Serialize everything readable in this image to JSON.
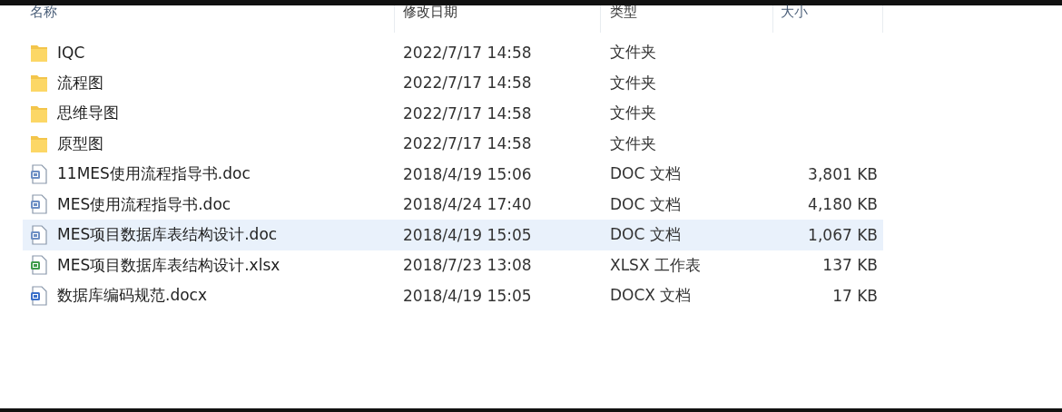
{
  "columns": [
    "名称",
    "修改日期",
    "类型",
    "大小"
  ],
  "files": [
    {
      "kind": "folder",
      "name": "IQC",
      "date": "2022/7/17 14:58",
      "type": "文件夹",
      "selected": false
    },
    {
      "kind": "folder",
      "name": "流程图",
      "date": "2022/7/17 14:58",
      "type": "文件夹",
      "selected": false
    },
    {
      "kind": "folder",
      "name": "思维导图",
      "date": "2022/7/17 14:58",
      "type": "文件夹",
      "selected": false
    },
    {
      "kind": "folder",
      "name": "原型图",
      "date": "2022/7/17 14:58",
      "type": "文件夹",
      "selected": false
    },
    {
      "kind": "doc",
      "name": "11MES使用流程指导书.doc",
      "date": "2018/4/19 15:06",
      "type": "DOC 文档",
      "size": "3,801 KB",
      "selected": false
    },
    {
      "kind": "doc",
      "name": "MES使用流程指导书.doc",
      "date": "2018/4/24 17:40",
      "type": "DOC 文档",
      "size": "4,180 KB",
      "selected": false
    },
    {
      "kind": "doc",
      "name": "MES项目数据库表结构设计.doc",
      "date": "2018/4/19 15:05",
      "type": "DOC 文档",
      "size": "1,067 KB",
      "selected": true
    },
    {
      "kind": "xlsx",
      "name": "MES项目数据库表结构设计.xlsx",
      "date": "2018/7/23 13:08",
      "type": "XLSX 工作表",
      "size": "137 KB",
      "selected": false
    },
    {
      "kind": "docx",
      "name": "数据库编码规范.docx",
      "date": "2018/4/19 15:05",
      "type": "DOCX 文档",
      "size": "17 KB",
      "selected": false
    }
  ]
}
